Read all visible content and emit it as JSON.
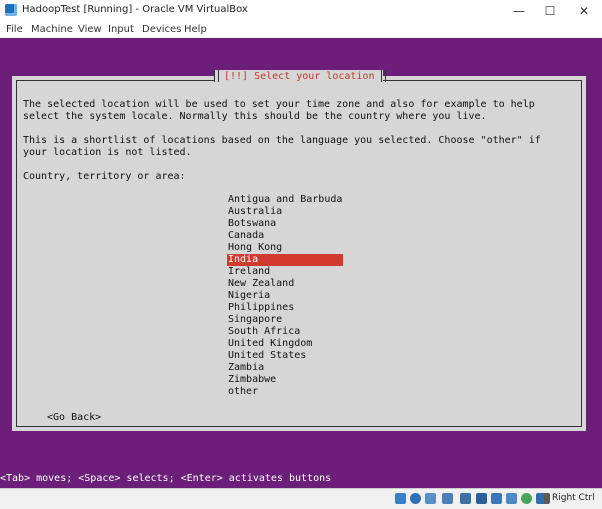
{
  "window": {
    "title": "HadoopTest [Running] - Oracle VM VirtualBox",
    "minimize_glyph": "—",
    "maximize_glyph": "☐",
    "close_glyph": "✕"
  },
  "menu": [
    "File",
    "Machine",
    "View",
    "Input",
    "Devices",
    "Help"
  ],
  "dialog": {
    "title": "[!!] Select your location",
    "paragraph1_line1": "The selected location will be used to set your time zone and also for example to help",
    "paragraph1_line2": "select the system locale. Normally this should be the country where you live.",
    "paragraph2_line1": "This is a shortlist of locations based on the language you selected. Choose \"other\" if",
    "paragraph2_line2": "your location is not listed.",
    "prompt": "Country, territory or area:",
    "countries": [
      "Antigua and Barbuda",
      "Australia",
      "Botswana",
      "Canada",
      "Hong Kong",
      "India",
      "Ireland",
      "New Zealand",
      "Nigeria",
      "Philippines",
      "Singapore",
      "South Africa",
      "United Kingdom",
      "United States",
      "Zambia",
      "Zimbabwe",
      "other"
    ],
    "selected": "India",
    "go_back": "<Go Back>"
  },
  "help_line": "<Tab> moves; <Space> selects; <Enter> activates buttons",
  "status": {
    "host_key": "Right Ctrl",
    "icons": [
      "hard-disk-icon",
      "optical-drive-icon",
      "audio-icon",
      "network-icon",
      "usb-icon",
      "shared-folders-icon",
      "display-icon",
      "video-capture-icon",
      "mouse-integration-icon",
      "keyboard-icon",
      "arrow-icon"
    ]
  },
  "colors": {
    "console_bg": "#6b1f78",
    "dialog_bg": "#d6d6d6",
    "selection": "#d13b2f",
    "title_text": "#c0392b"
  }
}
